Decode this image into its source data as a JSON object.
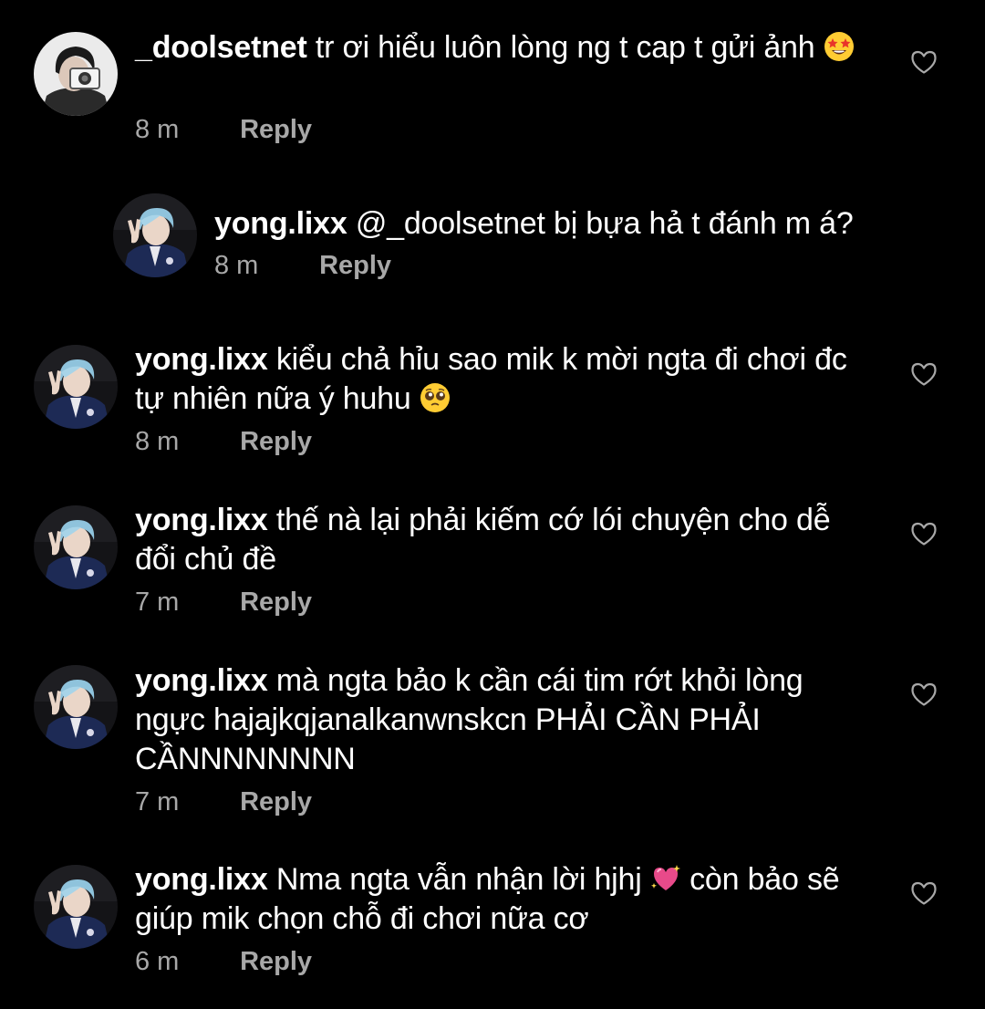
{
  "comments": [
    {
      "username": "_doolsetnet",
      "text": "tr ơi hiểu luôn lòng ng t cap t gửi ảnh",
      "emoji": "star-struck-emoji",
      "time": "8 m",
      "reply_label": "Reply",
      "avatar": "doolsetnet-avatar"
    },
    {
      "username": "yong.lixx",
      "text": "@_doolsetnet bị bựa hả t đánh m á?",
      "time": "8 m",
      "reply_label": "Reply",
      "avatar": "yonglixx-avatar",
      "nested": true
    },
    {
      "username": "yong.lixx",
      "text": "kiểu chả hỉu sao mik k mời ngta đi chơi đc tự nhiên nữa ý huhu",
      "emoji": "pleading-face-emoji",
      "time": "8 m",
      "reply_label": "Reply",
      "avatar": "yonglixx-avatar"
    },
    {
      "username": "yong.lixx",
      "text": "thế nà lại phải kiếm cớ lói chuyện cho dễ đổi chủ đề",
      "time": "7 m",
      "reply_label": "Reply",
      "avatar": "yonglixx-avatar"
    },
    {
      "username": "yong.lixx",
      "text": "mà ngta bảo k cần cái tim rớt khỏi lòng ngực hajajkqjanalkanwnskcn PHẢI CẦN PHẢI CẦNNNNNNNN",
      "time": "7 m",
      "reply_label": "Reply",
      "avatar": "yonglixx-avatar"
    },
    {
      "username": "yong.lixx",
      "text_before": "Nma ngta vẫn nhận lời hjhj",
      "emoji": "sparkling-heart-emoji",
      "text_after": "còn bảo sẽ giúp mik chọn chỗ đi chơi nữa cơ",
      "time": "6 m",
      "reply_label": "Reply",
      "avatar": "yonglixx-avatar"
    }
  ],
  "colors": {
    "background": "#000000",
    "text": "#ffffff",
    "meta": "#a8a8a8",
    "avatar_hair": "#8fc3dc",
    "avatar_jacket": "#1d2a55"
  }
}
